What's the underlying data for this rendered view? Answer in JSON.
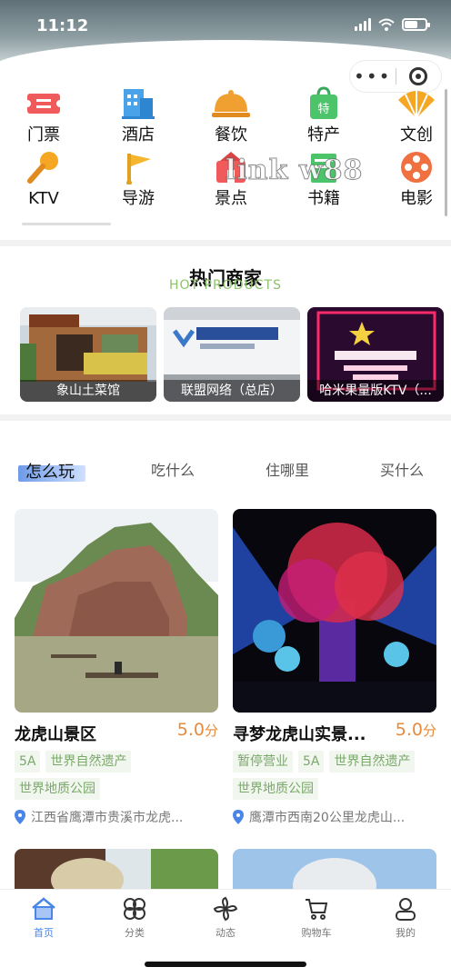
{
  "status_bar": {
    "time": "11:12"
  },
  "categories": [
    {
      "label": "门票",
      "icon": "ticket-icon",
      "color": "#f05a5a"
    },
    {
      "label": "酒店",
      "icon": "hotel-icon",
      "color": "#4aa3e8"
    },
    {
      "label": "餐饮",
      "icon": "dining-cloche-icon",
      "color": "#f0a030"
    },
    {
      "label": "特产",
      "icon": "specialty-bag-icon",
      "color": "#4cc46a"
    },
    {
      "label": "文创",
      "icon": "fan-icon",
      "color": "#f5a623"
    },
    {
      "label": "KTV",
      "icon": "microphone-icon",
      "color": "#f5a623"
    },
    {
      "label": "导游",
      "icon": "flag-icon",
      "color": "#f5b52e"
    },
    {
      "label": "景点",
      "icon": "scenic-icon",
      "color": "#f05a5a"
    },
    {
      "label": "书籍",
      "icon": "book-icon",
      "color": "#4cc46a"
    },
    {
      "label": "电影",
      "icon": "film-reel-icon",
      "color": "#f07040"
    }
  ],
  "watermark": "link w88",
  "hot": {
    "title": "热门商家",
    "subtitle": "HOT PRODUCTS",
    "merchants": [
      {
        "name": "象山土菜馆"
      },
      {
        "name": "联盟网络（总店）"
      },
      {
        "name": "哈米果量版KTV（..."
      }
    ]
  },
  "tabs": [
    {
      "label": "怎么玩",
      "active": true
    },
    {
      "label": "吃什么",
      "active": false
    },
    {
      "label": "住哪里",
      "active": false
    },
    {
      "label": "买什么",
      "active": false
    }
  ],
  "cards": [
    {
      "name": "龙虎山景区",
      "score": "5.0",
      "score_unit": "分",
      "tags": [
        "5A",
        "世界自然遗产",
        "世界地质公园"
      ],
      "address": "江西省鹰潭市贵溪市龙虎..."
    },
    {
      "name": "寻梦龙虎山实景...",
      "score": "5.0",
      "score_unit": "分",
      "tags": [
        "暂停营业",
        "5A",
        "世界自然遗产",
        "世界地质公园"
      ],
      "address": "鹰潭市西南20公里龙虎山..."
    }
  ],
  "bottom_nav": [
    {
      "label": "首页",
      "icon": "home-icon",
      "active": true
    },
    {
      "label": "分类",
      "icon": "category-grid-icon",
      "active": false
    },
    {
      "label": "动态",
      "icon": "pinwheel-icon",
      "active": false
    },
    {
      "label": "购物车",
      "icon": "cart-icon",
      "active": false
    },
    {
      "label": "我的",
      "icon": "user-icon",
      "active": false
    }
  ],
  "colors": {
    "accent": "#4a86e8",
    "score": "#e88a3a",
    "tag_text": "#7aa86a",
    "hot_subtitle": "#8cc26a"
  }
}
